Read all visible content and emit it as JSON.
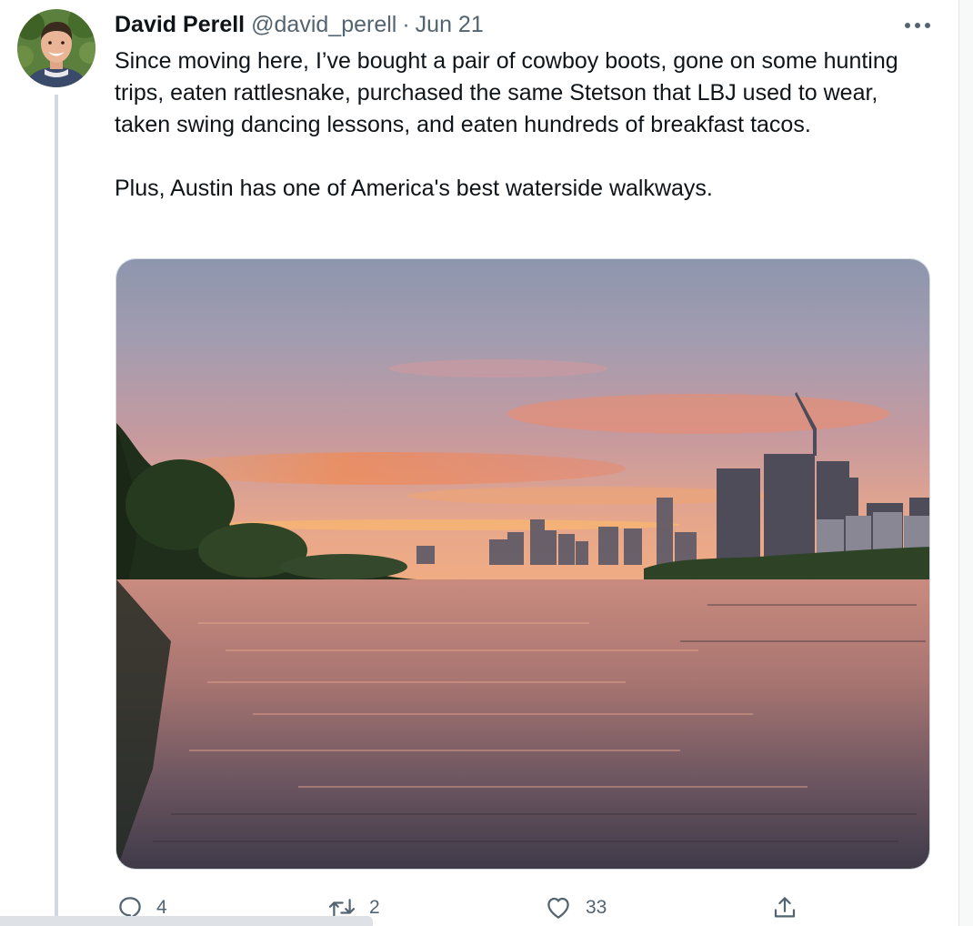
{
  "tweet": {
    "author_name": "David Perell",
    "author_handle": "@david_perell",
    "separator": "·",
    "date": "Jun 21",
    "text_paragraphs": [
      "Since moving here, I’ve bought a pair of cowboy boots, gone on some hunting trips, eaten rattlesnake, purchased the same Stetson that LBJ used to wear, taken swing dancing lessons, and eaten hundreds of breakfast tacos.",
      "Plus, Austin has one of America's best waterside walkways."
    ],
    "more_icon": "more-horizontal-icon"
  },
  "actions": {
    "reply": {
      "icon": "reply-icon",
      "count": "4"
    },
    "retweet": {
      "icon": "retweet-icon",
      "count": "2"
    },
    "like": {
      "icon": "heart-icon",
      "count": "33"
    },
    "share": {
      "icon": "share-icon"
    }
  },
  "colors": {
    "text_primary": "#0f1419",
    "text_secondary": "#536471",
    "thread_line": "#cfd9de",
    "background": "#ffffff"
  }
}
